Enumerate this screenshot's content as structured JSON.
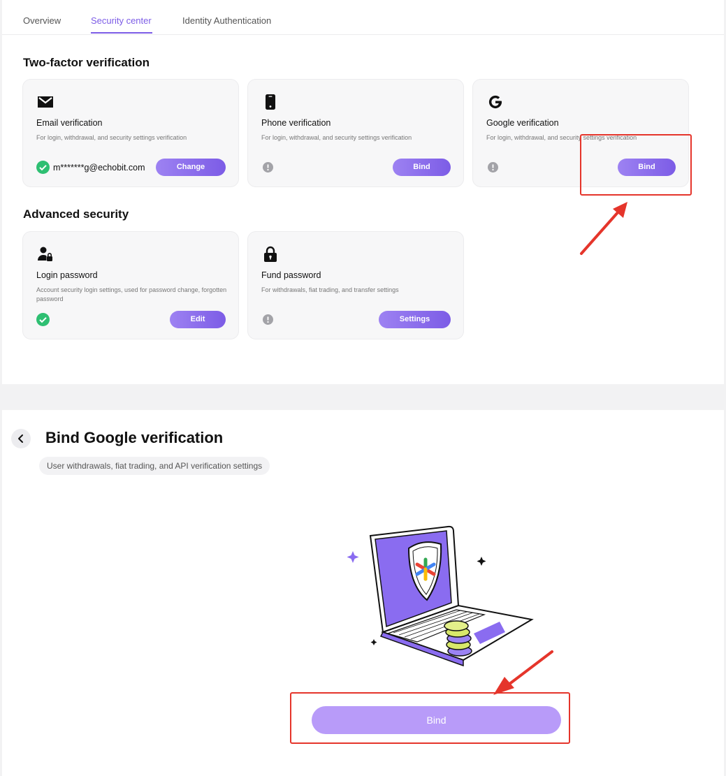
{
  "tabs": [
    {
      "label": "Overview"
    },
    {
      "label": "Security center"
    },
    {
      "label": "Identity Authentication"
    }
  ],
  "two_factor": {
    "title": "Two-factor verification",
    "cards": [
      {
        "icon": "envelope-icon",
        "title": "Email verification",
        "desc": "For login, withdrawal, and security settings verification",
        "status": "verified",
        "value": "m*******g@echobit.com",
        "button": "Change"
      },
      {
        "icon": "phone-icon",
        "title": "Phone verification",
        "desc": "For login, withdrawal, and security settings verification",
        "status": "unset",
        "button": "Bind"
      },
      {
        "icon": "google-g-icon",
        "title": "Google verification",
        "desc": "For login, withdrawal, and security settings verification",
        "status": "unset",
        "button": "Bind"
      }
    ]
  },
  "advanced": {
    "title": "Advanced security",
    "cards": [
      {
        "icon": "user-lock-icon",
        "title": "Login password",
        "desc": "Account security login settings, used for password change, forgotten password",
        "status": "verified",
        "button": "Edit"
      },
      {
        "icon": "padlock-icon",
        "title": "Fund password",
        "desc": "For withdrawals, fiat trading, and transfer settings",
        "status": "unset",
        "button": "Settings"
      }
    ]
  },
  "bind_page": {
    "title": "Bind Google verification",
    "subtitle": "User withdrawals, fiat trading, and API verification settings",
    "button": "Bind"
  },
  "colors": {
    "accent": "#7c5ce6",
    "button_light": "#b89bf9",
    "success": "#2ebf72",
    "annotation": "#e5352b"
  }
}
